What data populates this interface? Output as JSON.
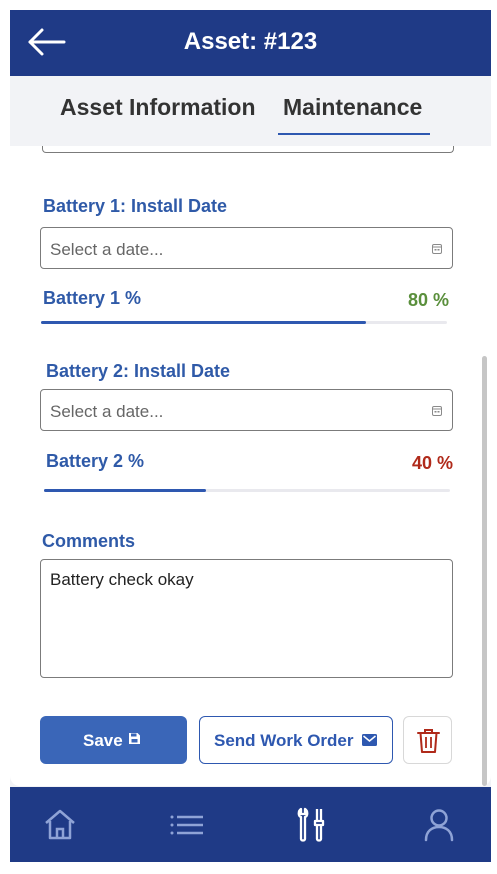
{
  "header": {
    "title": "Asset: #123",
    "back_icon": "back-arrow-icon"
  },
  "tabs": [
    {
      "label": "Asset Information",
      "selected": false
    },
    {
      "label": "Maintenance",
      "selected": true
    }
  ],
  "form": {
    "battery1": {
      "install_label": "Battery 1: Install Date",
      "date_placeholder": "Select a date...",
      "percent_label": "Battery 1 %",
      "percent_text": "80 %",
      "percent_value": 0.8,
      "percent_color": "#5a8f3c"
    },
    "battery2": {
      "install_label": "Battery 2: Install Date",
      "date_placeholder": "Select a date...",
      "percent_label": "Battery 2 %",
      "percent_text": "40 %",
      "percent_value": 0.4,
      "percent_color": "#b02a1a"
    },
    "comments": {
      "label": "Comments",
      "value": "Battery check okay"
    }
  },
  "actions": {
    "save_label": "Save",
    "send_label": "Send Work Order",
    "delete_icon": "trash-icon"
  },
  "nav": [
    {
      "icon": "home-icon"
    },
    {
      "icon": "list-icon"
    },
    {
      "icon": "tools-icon",
      "active": true
    },
    {
      "icon": "user-icon"
    }
  ],
  "colors": {
    "primary": "#1f3a86",
    "accent": "#2e58b0",
    "label": "#2f5aa8"
  }
}
